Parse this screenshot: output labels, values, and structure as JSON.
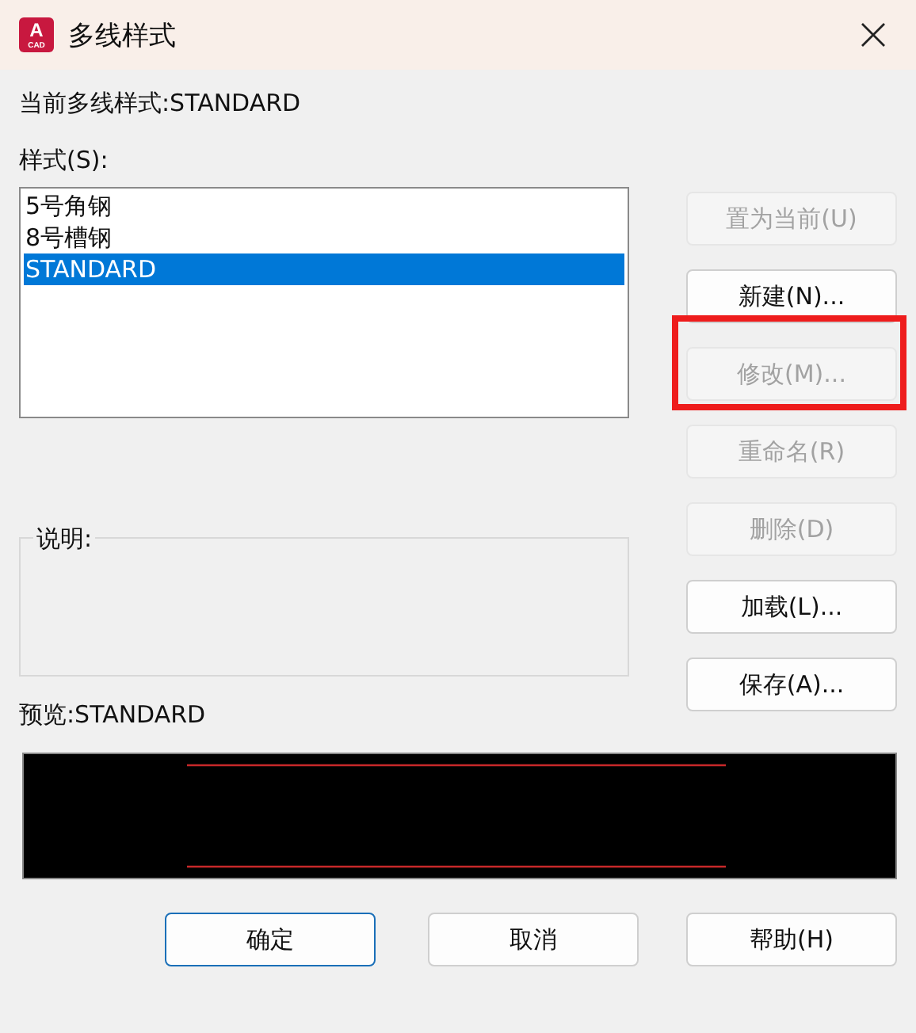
{
  "window": {
    "title": "多线样式",
    "app_icon": {
      "letter": "A",
      "caption": "CAD"
    }
  },
  "current_style": "当前多线样式:STANDARD",
  "styles_label": "样式(S):",
  "styles": [
    {
      "label": "5号角钢",
      "selected": false
    },
    {
      "label": "8号槽钢",
      "selected": false
    },
    {
      "label": "STANDARD",
      "selected": true
    }
  ],
  "side_buttons": [
    {
      "label": "置为当前(U)",
      "disabled": true,
      "highlighted": false
    },
    {
      "label": "新建(N)...",
      "disabled": false,
      "highlighted": false
    },
    {
      "label": "修改(M)...",
      "disabled": true,
      "highlighted": true
    },
    {
      "label": "重命名(R)",
      "disabled": true,
      "highlighted": false
    },
    {
      "label": "删除(D)",
      "disabled": true,
      "highlighted": false
    },
    {
      "label": "加载(L)...",
      "disabled": false,
      "highlighted": false
    },
    {
      "label": "保存(A)...",
      "disabled": false,
      "highlighted": false
    }
  ],
  "description": {
    "label": "说明:"
  },
  "preview_label": "预览:STANDARD",
  "bottom_buttons": [
    {
      "label": "确定",
      "default": true
    },
    {
      "label": "取消",
      "default": false
    },
    {
      "label": "帮助(H)",
      "default": false
    }
  ]
}
